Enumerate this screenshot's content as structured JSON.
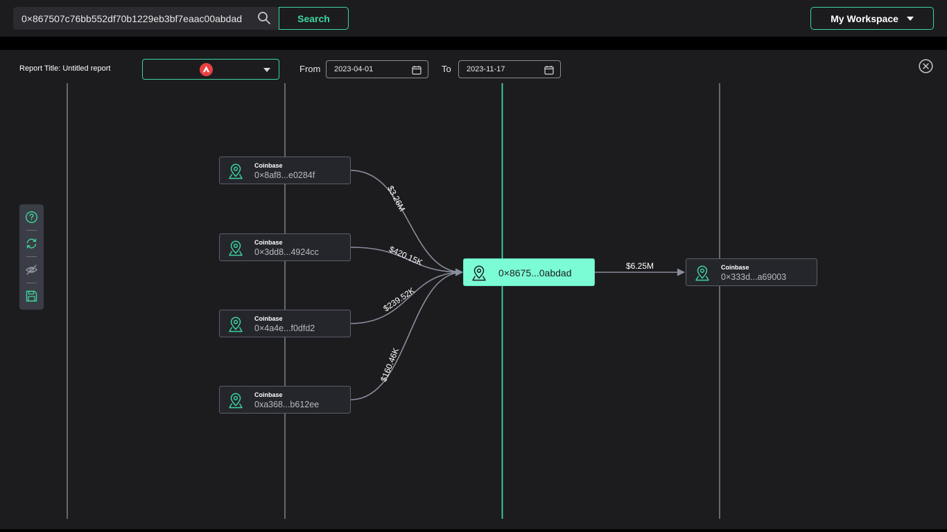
{
  "header": {
    "search_value": "0×867507c76bb552df70b1229eb3bf7eaac00abdad",
    "search_label": "Search",
    "workspace_label": "My Workspace"
  },
  "report": {
    "title_label": "Report Title: Untitled report",
    "chain_icon": "avalanche-icon",
    "from_label": "From",
    "from_date": "2023-04-01",
    "to_label": "To",
    "to_date": "2023-11-17"
  },
  "toolbar": [
    "help-icon",
    "refresh-icon",
    "hide-icon",
    "save-icon"
  ],
  "graph": {
    "center": {
      "address": "0×8675...0abdad"
    },
    "sources": [
      {
        "owner": "Coinbase",
        "address": "0×8af8...e0284f",
        "amount": "$3.26M"
      },
      {
        "owner": "Coinbase",
        "address": "0×3dd8...4924cc",
        "amount": "$420.15K"
      },
      {
        "owner": "Coinbase",
        "address": "0×4a4e...f0dfd2",
        "amount": "$239.52K"
      },
      {
        "owner": "Coinbase",
        "address": "0xa368...b612ee",
        "amount": "$160.46K"
      }
    ],
    "destinations": [
      {
        "owner": "Coinbase",
        "address": "0×333d...a69003",
        "amount": "$6.25M"
      }
    ]
  },
  "colors": {
    "accent": "#3ed6a0",
    "center_node": "#7cfcd4",
    "background": "#1c1c1f",
    "edge": "#8a8d9c"
  }
}
